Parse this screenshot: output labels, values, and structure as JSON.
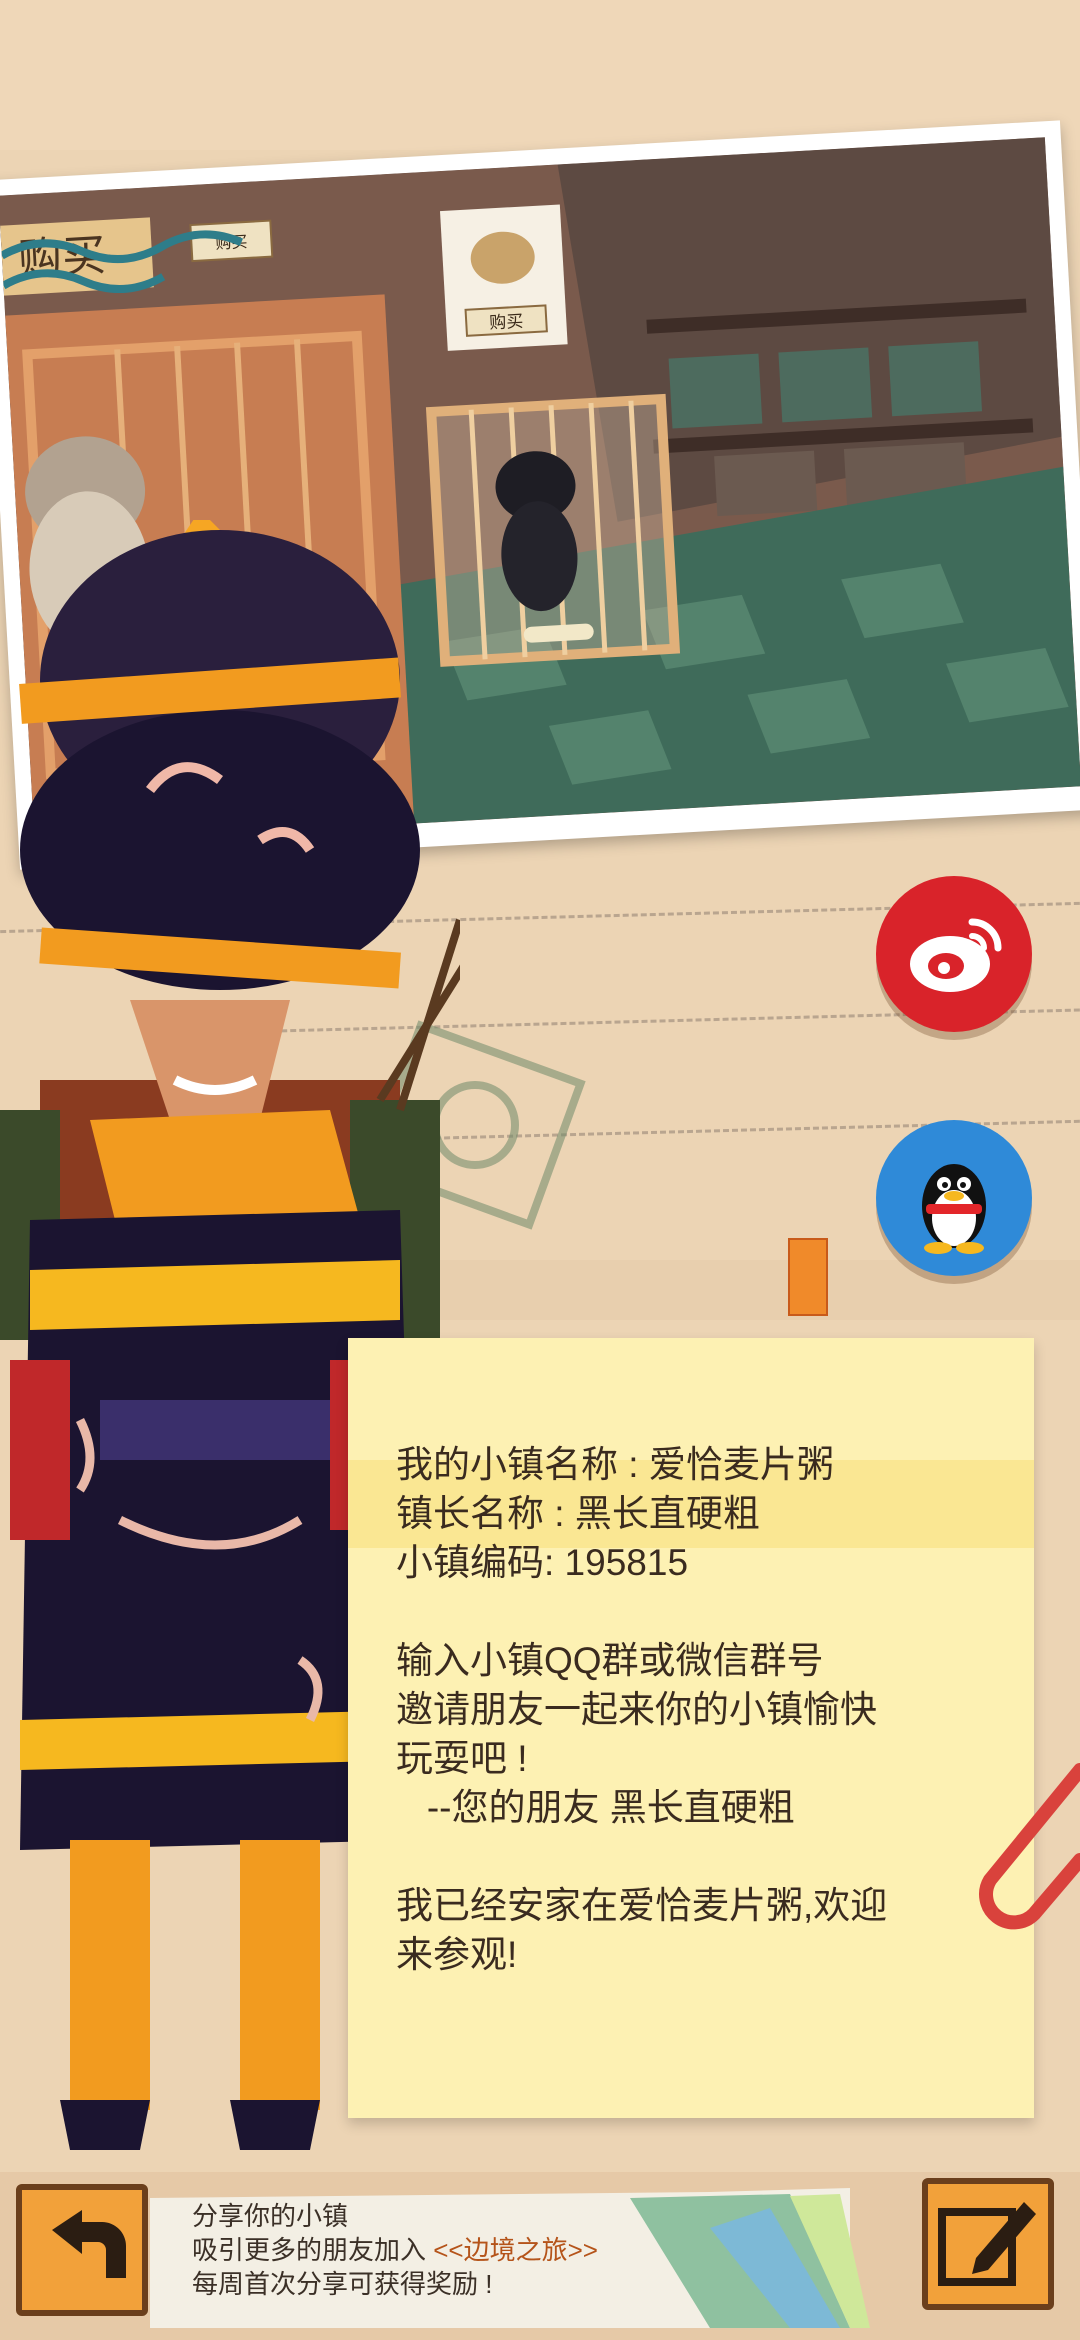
{
  "photo": {
    "sign_big": "购买",
    "sign_small": "购买",
    "sign_poster": "购买"
  },
  "social": {
    "weibo_icon": "weibo-icon",
    "qq_icon": "qq-penguin-icon"
  },
  "note": {
    "lines": [
      "我的小镇名称 : 爱恰麦片粥",
      "镇长名称 : 黑长直硬粗",
      "小镇编码: 195815",
      "",
      "输入小镇QQ群或微信群号",
      "邀请朋友一起来你的小镇愉快",
      "玩耍吧 !",
      "   --您的朋友 黑长直硬粗",
      "",
      "我已经安家在爱恰麦片粥,欢迎",
      "来参观!"
    ]
  },
  "bottom": {
    "back_icon": "back-arrow-icon",
    "share_line1": "分享你的小镇",
    "share_line2_prefix": "吸引更多的朋友加入 ",
    "share_line2_link": "<<边境之旅>>",
    "share_line3": "每周首次分享可获得奖励 !",
    "edit_icon": "edit-pen-icon"
  },
  "colors": {
    "background": "#ecd4b4",
    "note": "#fdf1b3",
    "weibo": "#d9232a",
    "qq": "#2f8ad8",
    "button": "#f2a13a",
    "link": "#b5541a"
  }
}
